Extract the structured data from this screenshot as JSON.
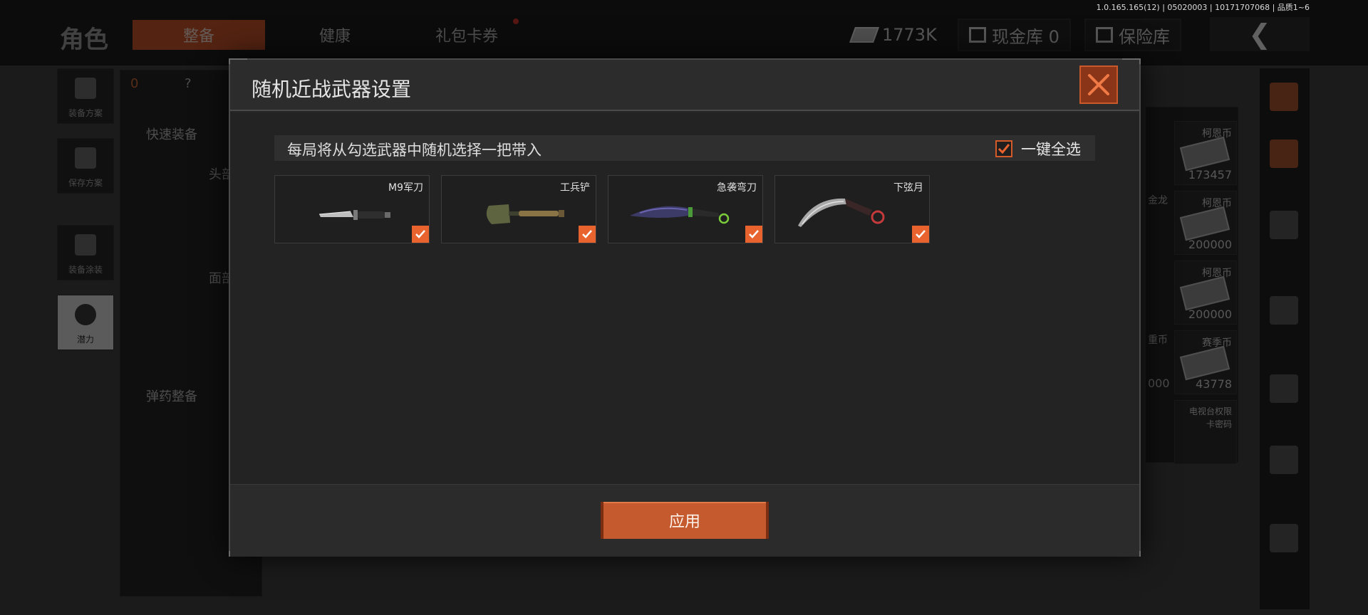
{
  "version": "1.0.165.165(12) | 05020003 | 10171707068 | 品质1~6",
  "header": {
    "page_title": "角色",
    "tabs": [
      {
        "label": "整备",
        "active": true
      },
      {
        "label": "健康",
        "active": false
      },
      {
        "label": "礼包卡券",
        "active": false,
        "has_dot": true
      }
    ],
    "currency": "1773K",
    "cash_vault": "现金库 0",
    "safe_box": "保险库",
    "back_icon": "chevron-left-icon"
  },
  "left_nav": [
    {
      "label": "装备方案",
      "icon": "vest-icon"
    },
    {
      "label": "保存方案",
      "icon": "download-icon"
    },
    {
      "label": "装备涂装",
      "icon": "soldier-icon"
    },
    {
      "label": "潜力",
      "icon": "power-hex-icon",
      "active": true
    }
  ],
  "background": {
    "armor_count": "0",
    "help": "?",
    "quick_equip": "快速装备",
    "head_label": "头部",
    "face_label": "面部",
    "ammo_label": "弹药整备",
    "money_cards": [
      {
        "name": "柯恩币",
        "value": "173457"
      },
      {
        "name": "柯恩币",
        "value": "200000"
      },
      {
        "name": "柯恩币",
        "value": "200000"
      },
      {
        "name": "赛季币",
        "value": "43778"
      }
    ],
    "partial_left_values": [
      "金龙",
      "重币",
      "000"
    ],
    "bottom_labels": [
      "电视台权限",
      "卡密码"
    ]
  },
  "modal": {
    "title": "随机近战武器设置",
    "close_icon": "close-icon",
    "instruction": "每局将从勾选武器中随机选择一把带入",
    "select_all": {
      "label": "一键全选",
      "checked": true
    },
    "weapons": [
      {
        "name": "M9军刀",
        "checked": true,
        "icon": "combat-knife-icon"
      },
      {
        "name": "工兵铲",
        "checked": true,
        "icon": "shovel-icon"
      },
      {
        "name": "急袭弯刀",
        "checked": true,
        "icon": "machete-icon"
      },
      {
        "name": "下弦月",
        "checked": true,
        "icon": "karambit-icon"
      }
    ],
    "apply_label": "应用"
  },
  "colors": {
    "accent": "#e8632e",
    "button": "#c55a2e",
    "close_bg": "#8a3418"
  }
}
